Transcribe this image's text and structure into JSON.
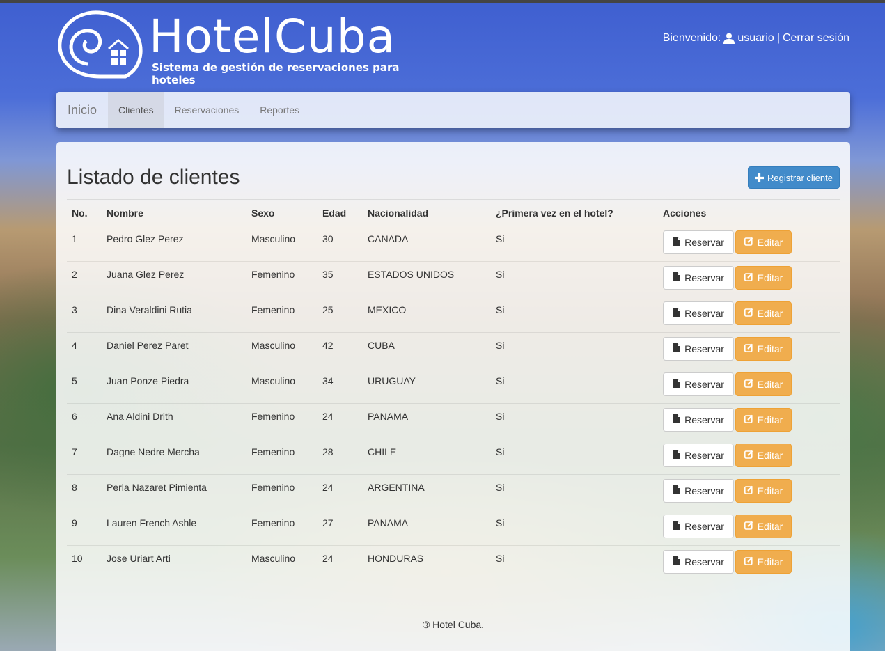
{
  "header": {
    "logo_title": "HotelCuba",
    "logo_subtitle": "Sistema de gestión de reservaciones para hoteles",
    "welcome_label": "Bienvenido:",
    "user_icon": "user-icon",
    "username": "usuario",
    "separator": "|",
    "logout": "Cerrar sesión"
  },
  "nav": {
    "brand": "Inicio",
    "items": [
      {
        "label": "Clientes",
        "active": true
      },
      {
        "label": "Reservaciones",
        "active": false
      },
      {
        "label": "Reportes",
        "active": false
      }
    ]
  },
  "main": {
    "title": "Listado de clientes",
    "register_button": "Registrar cliente",
    "register_icon": "plus-icon",
    "columns": [
      "No.",
      "Nombre",
      "Sexo",
      "Edad",
      "Nacionalidad",
      "¿Primera vez en el hotel?",
      "Acciones"
    ],
    "reserve_label": "Reservar",
    "reserve_icon": "file-icon",
    "edit_label": "Editar",
    "edit_icon": "edit-icon",
    "rows": [
      {
        "no": "1",
        "name": "Pedro Glez Perez",
        "sex": "Masculino",
        "age": "30",
        "nationality": "CANADA",
        "first": "Si"
      },
      {
        "no": "2",
        "name": "Juana Glez Perez",
        "sex": "Femenino",
        "age": "35",
        "nationality": "ESTADOS UNIDOS",
        "first": "Si"
      },
      {
        "no": "3",
        "name": "Dina Veraldini Rutia",
        "sex": "Femenino",
        "age": "25",
        "nationality": "MEXICO",
        "first": "Si"
      },
      {
        "no": "4",
        "name": "Daniel Perez Paret",
        "sex": "Masculino",
        "age": "42",
        "nationality": "CUBA",
        "first": "Si"
      },
      {
        "no": "5",
        "name": "Juan Ponze Piedra",
        "sex": "Masculino",
        "age": "34",
        "nationality": "URUGUAY",
        "first": "Si"
      },
      {
        "no": "6",
        "name": "Ana Aldini Drith",
        "sex": "Femenino",
        "age": "24",
        "nationality": "PANAMA",
        "first": "Si"
      },
      {
        "no": "7",
        "name": "Dagne Nedre Mercha",
        "sex": "Femenino",
        "age": "28",
        "nationality": "CHILE",
        "first": "Si"
      },
      {
        "no": "8",
        "name": "Perla Nazaret Pimienta",
        "sex": "Femenino",
        "age": "24",
        "nationality": "ARGENTINA",
        "first": "Si"
      },
      {
        "no": "9",
        "name": "Lauren French Ashle",
        "sex": "Femenino",
        "age": "27",
        "nationality": "PANAMA",
        "first": "Si"
      },
      {
        "no": "10",
        "name": "Jose Uriart Arti",
        "sex": "Masculino",
        "age": "24",
        "nationality": "HONDURAS",
        "first": "Si"
      }
    ]
  },
  "footer": {
    "text": "® Hotel Cuba."
  },
  "colors": {
    "primary": "#428bca",
    "warning": "#f0ad4e",
    "nav_bg": "#ecf0fa"
  }
}
